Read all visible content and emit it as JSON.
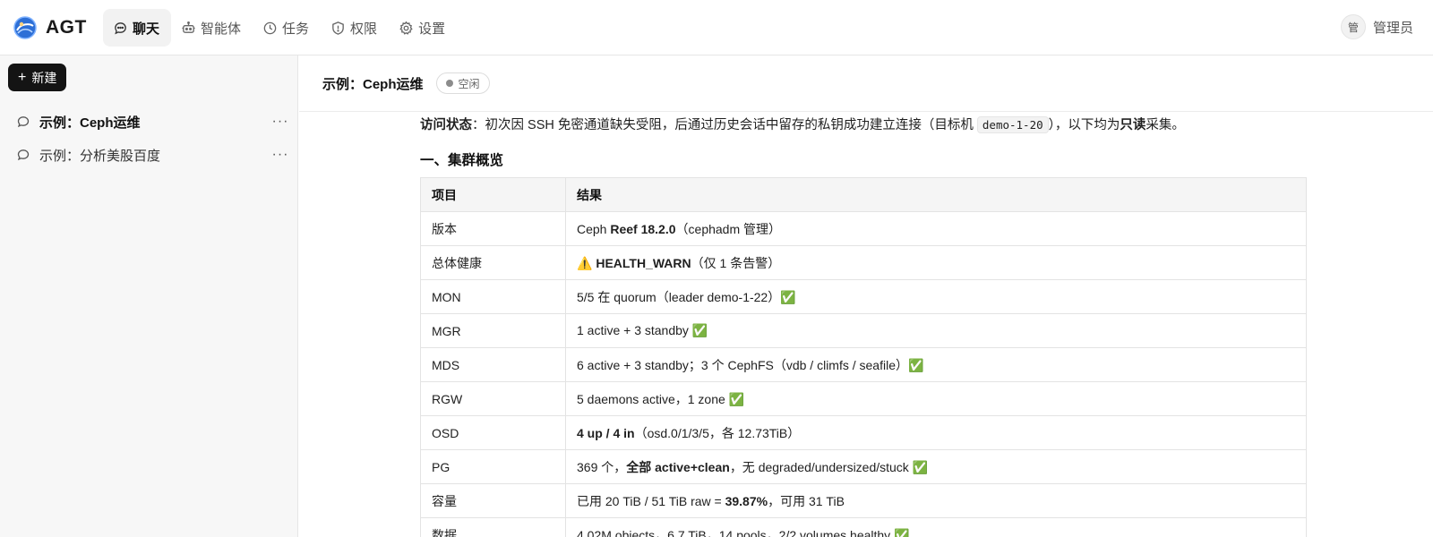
{
  "brand": {
    "name": "AGT",
    "logo": "brand-logo"
  },
  "nav": [
    {
      "label": "聊天",
      "icon": "chat-icon",
      "active": true
    },
    {
      "label": "智能体",
      "icon": "robot-icon",
      "active": false
    },
    {
      "label": "任务",
      "icon": "clock-icon",
      "active": false
    },
    {
      "label": "权限",
      "icon": "shield-icon",
      "active": false
    },
    {
      "label": "设置",
      "icon": "gear-icon",
      "active": false
    }
  ],
  "user": {
    "avatar_text": "管",
    "name": "管理员"
  },
  "sidebar": {
    "new_label": "新建",
    "conversations": [
      {
        "label": "示例：Ceph运维",
        "active": true,
        "more": "···"
      },
      {
        "label": "示例：分析美股百度",
        "active": false,
        "more": "···"
      }
    ]
  },
  "main": {
    "title": "示例：Ceph运维",
    "status": "空闲",
    "access": {
      "label": "访问状态",
      "text1": "：初次因 SSH 免密通道缺失受阻，后通过历史会话中留存的私钥成功建立连接（目标机 ",
      "host": "demo-1-20",
      "text2": "），以下均为",
      "readonly": "只读",
      "text3": "采集。"
    },
    "section_title": "一、集群概览",
    "table": {
      "headers": [
        "项目",
        "结果"
      ],
      "rows": [
        {
          "k": "版本",
          "a": "Ceph ",
          "b": "Reef 18.2.0",
          "c": "（cephadm 管理）"
        },
        {
          "k": "总体健康",
          "a": "⚠️ ",
          "b": "HEALTH_WARN",
          "c": "（仅 1 条告警）"
        },
        {
          "k": "MON",
          "a": "5/5 在 quorum（leader demo-1-22）✅",
          "b": "",
          "c": ""
        },
        {
          "k": "MGR",
          "a": "1 active + 3 standby ✅",
          "b": "",
          "c": ""
        },
        {
          "k": "MDS",
          "a": "6 active + 3 standby；3 个 CephFS（vdb / climfs / seafile）✅",
          "b": "",
          "c": ""
        },
        {
          "k": "RGW",
          "a": "5 daemons active，1 zone ✅",
          "b": "",
          "c": ""
        },
        {
          "k": "OSD",
          "a": "",
          "b": "4 up / 4 in",
          "c": "（osd.0/1/3/5，各 12.73TiB）"
        },
        {
          "k": "PG",
          "a": "369 个，",
          "b": "全部 active+clean",
          "c": "，无 degraded/undersized/stuck ✅"
        },
        {
          "k": "容量",
          "a": "已用 20 TiB / 51 TiB raw = ",
          "b": "39.87%",
          "c": "，可用 31 TiB"
        },
        {
          "k": "数据",
          "a": "4.02M objects，6.7 TiB，14 pools，2/2 volumes healthy ✅",
          "b": "",
          "c": ""
        }
      ]
    }
  }
}
